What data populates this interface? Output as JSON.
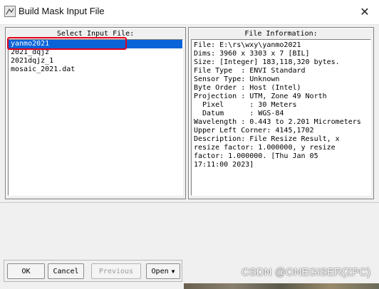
{
  "window": {
    "title": "Build Mask Input File",
    "close_glyph": "✕"
  },
  "left_panel": {
    "label": "Select Input File:",
    "files": [
      {
        "name": "yanmo2021",
        "selected": true
      },
      {
        "name": "2021_dqjz",
        "selected": false
      },
      {
        "name": "2021dqjz_1",
        "selected": false
      },
      {
        "name": "mosaic_2021.dat",
        "selected": false
      }
    ]
  },
  "right_panel": {
    "label": "File Information:",
    "lines": [
      "File: E:\\rs\\wxy\\yanmo2021",
      "Dims: 3960 x 3303 x 7 [BIL]",
      "Size: [Integer] 183,118,320 bytes.",
      "File Type  : ENVI Standard",
      "Sensor Type: Unknown",
      "Byte Order : Host (Intel)",
      "Projection : UTM, Zone 49 North",
      "  Pixel      : 30 Meters",
      "  Datum      : WGS-84",
      "Wavelength : 0.443 to 2.201 Micrometers",
      "Upper Left Corner: 4145,1702",
      "Description: File Resize Result, x",
      "resize factor: 1.000000, y resize",
      "factor: 1.000000. [Thu Jan 05",
      "17:11:00 2023]"
    ]
  },
  "buttons": {
    "ok": "OK",
    "cancel": "Cancel",
    "previous": "Previous",
    "open": "Open"
  },
  "watermark": "CSDN @ONEGISER(ZPC)",
  "colors": {
    "selection": "#0a64d8",
    "annotation": "#e4001b"
  }
}
